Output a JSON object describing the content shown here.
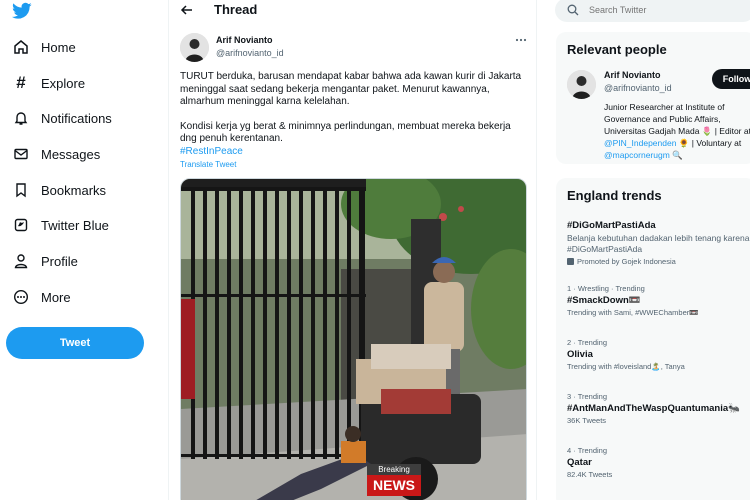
{
  "nav": {
    "items": [
      {
        "label": "Home",
        "icon": "home-icon"
      },
      {
        "label": "Explore",
        "icon": "hashtag-icon"
      },
      {
        "label": "Notifications",
        "icon": "bell-icon"
      },
      {
        "label": "Messages",
        "icon": "envelope-icon"
      },
      {
        "label": "Bookmarks",
        "icon": "bookmark-icon"
      },
      {
        "label": "Twitter Blue",
        "icon": "twitter-blue-icon"
      },
      {
        "label": "Profile",
        "icon": "person-icon"
      },
      {
        "label": "More",
        "icon": "more-circle-icon"
      }
    ],
    "tweet_button": "Tweet"
  },
  "thread": {
    "title": "Thread",
    "author_name": "Arif Novianto",
    "author_handle": "@arifnovianto_id",
    "text_p1": "TURUT berduka, barusan mendapat kabar bahwa ada kawan kurir di Jakarta meninggal saat sedang bekerja mengantar paket. Menurut kawannya, almarhum meninggal karna kelelahan.",
    "text_p2": "Kondisi kerja yg berat & minimnya perlindungan, membuat mereka bekerja dng penuh kerentanan.",
    "hashtag": "#RestInPeace",
    "translate": "Translate Tweet",
    "news_top": "Breaking",
    "news_bottom": "NEWS"
  },
  "search": {
    "placeholder": "Search Twitter"
  },
  "relevant": {
    "title": "Relevant people",
    "name": "Arif Novianto",
    "handle": "@arifnovianto_id",
    "follow": "Follow",
    "bio_a": "Junior Researcher at Institute of Governance and Public Affairs, Universitas Gadjah Mada 🌷 | Editor at ",
    "bio_m1": "@PIN_Independen",
    "bio_b": " 🌻 | Voluntary at ",
    "bio_m2": "@mapcornerugm",
    "bio_c": " 🔍"
  },
  "trends": {
    "title": "England trends",
    "items": [
      {
        "name": "#DiGoMartPastiAda",
        "desc": "Belanja kebutuhan dadakan lebih tenang karena #DiGoMartPastiAda",
        "sub": "Promoted by Gojek Indonesia"
      },
      {
        "meta": "1 · Wrestling · Trending",
        "name": "#SmackDown📼",
        "sub": "Trending with Sami, #WWEChamber📼"
      },
      {
        "meta": "2 · Trending",
        "name": "Olivia",
        "sub": "Trending with #loveisland🏝️, Tanya"
      },
      {
        "meta": "3 · Trending",
        "name": "#AntManAndTheWaspQuantumania🐜",
        "sub": "36K Tweets"
      },
      {
        "meta": "4 · Trending",
        "name": "Qatar",
        "sub": "82.4K Tweets"
      }
    ]
  },
  "colors": {
    "accent": "#1d9bf0",
    "text": "#0f1419",
    "muted": "#536471"
  }
}
